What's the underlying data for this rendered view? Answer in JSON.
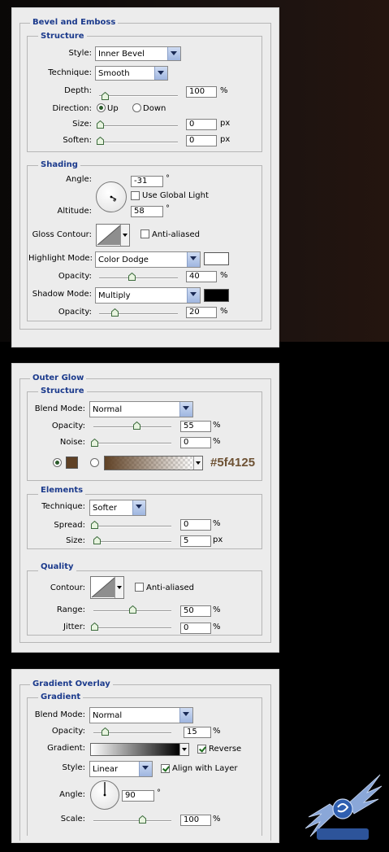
{
  "bevel": {
    "title": "Bevel and Emboss",
    "structure": {
      "title": "Structure",
      "style_label": "Style:",
      "style_value": "Inner Bevel",
      "technique_label": "Technique:",
      "technique_value": "Smooth",
      "depth_label": "Depth:",
      "depth_value": "100",
      "depth_unit": "%",
      "direction_label": "Direction:",
      "dir_up": "Up",
      "dir_down": "Down",
      "size_label": "Size:",
      "size_value": "0",
      "size_unit": "px",
      "soften_label": "Soften:",
      "soften_value": "0",
      "soften_unit": "px"
    },
    "shading": {
      "title": "Shading",
      "angle_label": "Angle:",
      "angle_value": "-31",
      "angle_unit": "°",
      "global_light": "Use Global Light",
      "altitude_label": "Altitude:",
      "altitude_value": "58",
      "altitude_unit": "°",
      "gloss_label": "Gloss Contour:",
      "anti_aliased": "Anti-aliased",
      "highlight_label": "Highlight Mode:",
      "highlight_value": "Color Dodge",
      "highlight_color": "#ffffff",
      "h_opacity_label": "Opacity:",
      "h_opacity_value": "40",
      "h_opacity_unit": "%",
      "shadow_label": "Shadow Mode:",
      "shadow_value": "Multiply",
      "shadow_color": "#000000",
      "s_opacity_label": "Opacity:",
      "s_opacity_value": "20",
      "s_opacity_unit": "%"
    }
  },
  "outer_glow": {
    "title": "Outer Glow",
    "structure": {
      "title": "Structure",
      "blend_label": "Blend Mode:",
      "blend_value": "Normal",
      "opacity_label": "Opacity:",
      "opacity_value": "55",
      "opacity_unit": "%",
      "noise_label": "Noise:",
      "noise_value": "0",
      "noise_unit": "%",
      "color": "#5f4125",
      "color_text": "#5f4125"
    },
    "elements": {
      "title": "Elements",
      "technique_label": "Technique:",
      "technique_value": "Softer",
      "spread_label": "Spread:",
      "spread_value": "0",
      "spread_unit": "%",
      "size_label": "Size:",
      "size_value": "5",
      "size_unit": "px"
    },
    "quality": {
      "title": "Quality",
      "contour_label": "Contour:",
      "anti_aliased": "Anti-aliased",
      "range_label": "Range:",
      "range_value": "50",
      "range_unit": "%",
      "jitter_label": "Jitter:",
      "jitter_value": "0",
      "jitter_unit": "%"
    }
  },
  "gradient_overlay": {
    "title": "Gradient Overlay",
    "gradient": {
      "title": "Gradient",
      "blend_label": "Blend Mode:",
      "blend_value": "Normal",
      "opacity_label": "Opacity:",
      "opacity_value": "15",
      "opacity_unit": "%",
      "gradient_label": "Gradient:",
      "reverse": "Reverse",
      "style_label": "Style:",
      "style_value": "Linear",
      "align": "Align with Layer",
      "angle_label": "Angle:",
      "angle_value": "90",
      "angle_unit": "°",
      "scale_label": "Scale:",
      "scale_value": "100",
      "scale_unit": "%"
    }
  }
}
